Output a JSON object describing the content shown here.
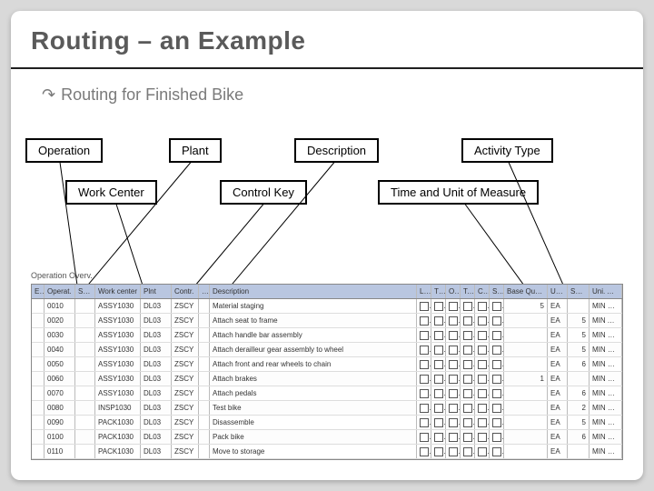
{
  "title": "Routing – an Example",
  "bullet": {
    "glyph": "↷",
    "text": "Routing for Finished Bike"
  },
  "labels": {
    "operation": "Operation",
    "plant": "Plant",
    "description": "Description",
    "activity": "Activity Type",
    "workcenter": "Work Center",
    "controlkey": "Control Key",
    "time": "Time and Unit of Measure"
  },
  "table_title": "Operation Overv.",
  "columns": {
    "ex": "Ex",
    "op": "Operat.",
    "sc": "SOp",
    "wc": "Work center",
    "pl": "Plnt",
    "ck": "Contr.",
    "st": "…Standard",
    "ds": "Description",
    "lo": "Lo…",
    "tr": "TRTC…",
    "ol": "O…",
    "ta": "Ta…",
    "cl": "Cl…",
    "su": "Su…",
    "bq": "Base Quantity",
    "un": "U…",
    "se": "Set…",
    "u2": "Uni. ActMNE…"
  },
  "rows": [
    {
      "op": "0010",
      "wc": "ASSY1030",
      "pl": "DL03",
      "ck": "ZSCY",
      "ds": "Material staging",
      "bq": "5",
      "un": "EA",
      "se": "",
      "u2": "MIN  LABOR"
    },
    {
      "op": "0020",
      "wc": "ASSY1030",
      "pl": "DL03",
      "ck": "ZSCY",
      "ds": "Attach seat to frame",
      "bq": "",
      "un": "EA",
      "se": "5",
      "u2": "MIN  ASUR"
    },
    {
      "op": "0030",
      "wc": "ASSY1030",
      "pl": "DL03",
      "ck": "ZSCY",
      "ds": "Attach handle bar assembly",
      "bq": "",
      "un": "EA",
      "se": "5",
      "u2": "MIN  LABOR"
    },
    {
      "op": "0040",
      "wc": "ASSY1030",
      "pl": "DL03",
      "ck": "ZSCY",
      "ds": "Attach derailleur gear assembly to wheel",
      "bq": "",
      "un": "EA",
      "se": "5",
      "u2": "MIN  LABOR"
    },
    {
      "op": "0050",
      "wc": "ASSY1030",
      "pl": "DL03",
      "ck": "ZSCY",
      "ds": "Attach front and rear wheels to chain",
      "bq": "",
      "un": "EA",
      "se": "6",
      "u2": "MIN  LABOR"
    },
    {
      "op": "0060",
      "wc": "ASSY1030",
      "pl": "DL03",
      "ck": "ZSCY",
      "ds": "Attach brakes",
      "bq": "1",
      "un": "EA",
      "se": "",
      "u2": "MIN  LABOR"
    },
    {
      "op": "0070",
      "wc": "ASSY1030",
      "pl": "DL03",
      "ck": "ZSCY",
      "ds": "Attach pedals",
      "bq": "",
      "un": "EA",
      "se": "6",
      "u2": "MIN  LABOR"
    },
    {
      "op": "0080",
      "wc": "INSP1030",
      "pl": "DL03",
      "ck": "ZSCY",
      "ds": "Test bike",
      "bq": "",
      "un": "EA",
      "se": "2",
      "u2": "MIN  LABOR"
    },
    {
      "op": "0090",
      "wc": "PACK1030",
      "pl": "DL03",
      "ck": "ZSCY",
      "ds": "Disassemble",
      "bq": "",
      "un": "EA",
      "se": "5",
      "u2": "MIN  LABOR"
    },
    {
      "op": "0100",
      "wc": "PACK1030",
      "pl": "DL03",
      "ck": "ZSCY",
      "ds": "Pack bike",
      "bq": "",
      "un": "EA",
      "se": "6",
      "u2": "MIN  LABOR"
    },
    {
      "op": "0110",
      "wc": "PACK1030",
      "pl": "DL03",
      "ck": "ZSCY",
      "ds": "Move to storage",
      "bq": "",
      "un": "EA",
      "se": "",
      "u2": "MIN  LABOR"
    }
  ]
}
